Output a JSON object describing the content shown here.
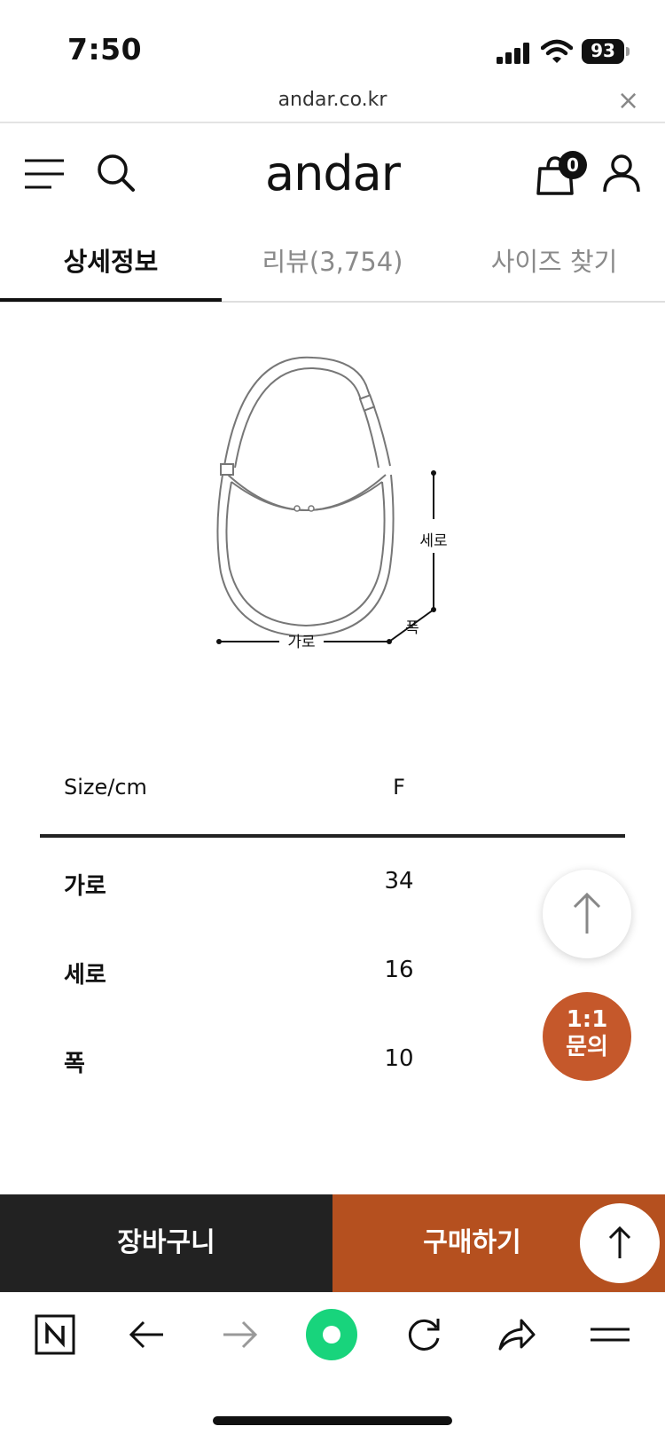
{
  "status_bar": {
    "time": "7:50",
    "battery": "93"
  },
  "url_bar": {
    "url": "andar.co.kr",
    "close": "×"
  },
  "header": {
    "logo": "andar",
    "cart_count": "0"
  },
  "tabs": [
    {
      "label": "상세정보",
      "active": true
    },
    {
      "label": "리뷰(3,754)",
      "active": false
    },
    {
      "label": "사이즈 찾기",
      "active": false
    }
  ],
  "illustration": {
    "height_label": "세로",
    "depth_label": "폭",
    "width_label": "가로"
  },
  "size_table": {
    "header": {
      "label": "Size/cm",
      "size": "F"
    },
    "rows": [
      {
        "label": "가로",
        "value": "34"
      },
      {
        "label": "세로",
        "value": "16"
      },
      {
        "label": "폭",
        "value": "10"
      }
    ]
  },
  "floating": {
    "inquiry_line1": "1:1",
    "inquiry_line2": "문의"
  },
  "bottom_bar": {
    "cart": "장바구니",
    "buy": "구매하기"
  },
  "colors": {
    "accent": "#b5501f",
    "inquiry": "#c5582b",
    "dark": "#222222"
  }
}
